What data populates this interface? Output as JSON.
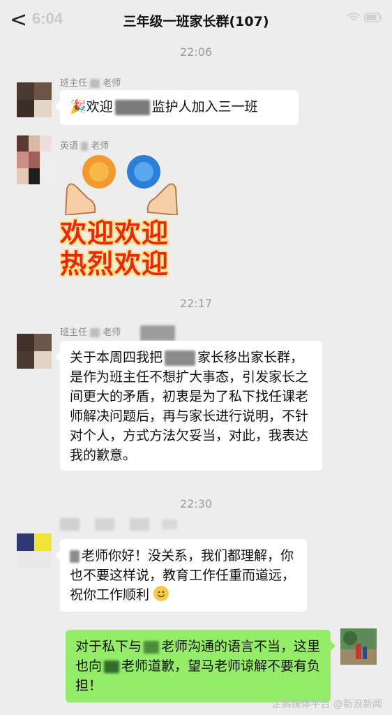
{
  "status_bar": {
    "time": "6:04"
  },
  "header": {
    "back_glyph": "<",
    "title": "三年级一班家长群(107)"
  },
  "messages": [
    {
      "time": "22:06",
      "sender": "班主任",
      "sender_suffix": "老师",
      "segments": [
        "🎉欢迎",
        "监护人加入三一班"
      ]
    },
    {
      "sender": "英语",
      "sender_suffix": "老师",
      "sticker_lines": [
        "欢迎欢迎",
        "热烈欢迎"
      ]
    },
    {
      "time": "22:17",
      "sender": "班主任",
      "sender_suffix": "老师",
      "text_start": "关于本周四我把",
      "text_rest": "家长移出家长群，是作为班主任不想扩大事态，引发家长之间更大的矛盾，初衷是为了私下找任课老师解决问题后，再与家长进行说明，不针对个人，方式方法欠妥当，对此，我表达我的歉意。"
    },
    {
      "time": "22:30",
      "text_start": "老师你好！没关系，我们都理解，你也不要这样说，教育工作任重而道远，祝你工作顺利"
    },
    {
      "text_a": "对于私下与",
      "text_b": "老师沟通的语言不当，这里也向",
      "text_c": "老师道歉，望马老师谅解不要有负担！"
    }
  ],
  "watermark": "企鹅媒体平台 @新浪新闻",
  "colors": {
    "chat_bg": "#ededed",
    "bubble_white": "#ffffff",
    "bubble_green": "#95ec69",
    "time_gray": "#9b9b9b"
  }
}
